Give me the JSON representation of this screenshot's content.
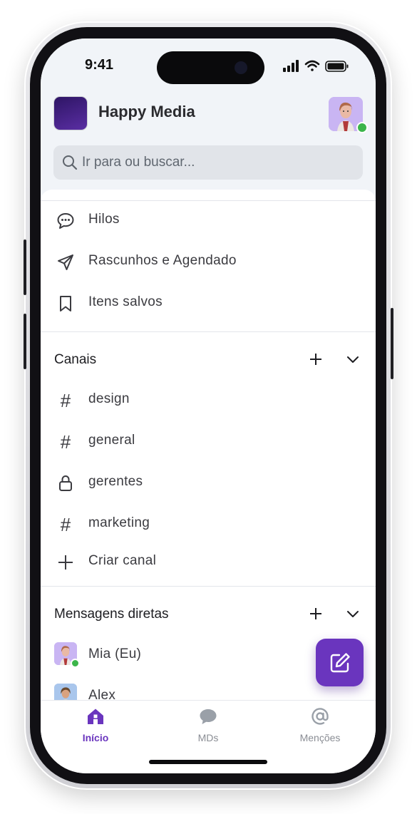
{
  "status_bar": {
    "time": "9:41"
  },
  "workspace": {
    "name": "Happy Media"
  },
  "search": {
    "placeholder": "Ir para ou buscar..."
  },
  "quick_links": [
    {
      "label": "Hilos",
      "icon": "chat-bubble-icon"
    },
    {
      "label": "Rascunhos e Agendado",
      "icon": "paper-plane-icon"
    },
    {
      "label": "Itens salvos",
      "icon": "bookmark-icon"
    }
  ],
  "channels": {
    "title": "Canais",
    "items": [
      {
        "label": "design",
        "icon": "hash-icon"
      },
      {
        "label": "general",
        "icon": "hash-icon"
      },
      {
        "label": "gerentes",
        "icon": "lock-icon"
      },
      {
        "label": "marketing",
        "icon": "hash-icon"
      }
    ],
    "create_label": "Criar canal"
  },
  "direct_messages": {
    "title": "Mensagens diretas",
    "items": [
      {
        "label": "Mia (Eu)",
        "online": true
      },
      {
        "label": "Alex",
        "online": false
      }
    ]
  },
  "tabs": [
    {
      "label": "Início",
      "icon": "home-icon",
      "active": true
    },
    {
      "label": "MDs",
      "icon": "speech-bubble-icon",
      "active": false
    },
    {
      "label": "Menções",
      "icon": "at-icon",
      "active": false
    }
  ],
  "colors": {
    "accent": "#6a35be",
    "online": "#3bb54a",
    "header_bg": "#f1f4f8"
  }
}
